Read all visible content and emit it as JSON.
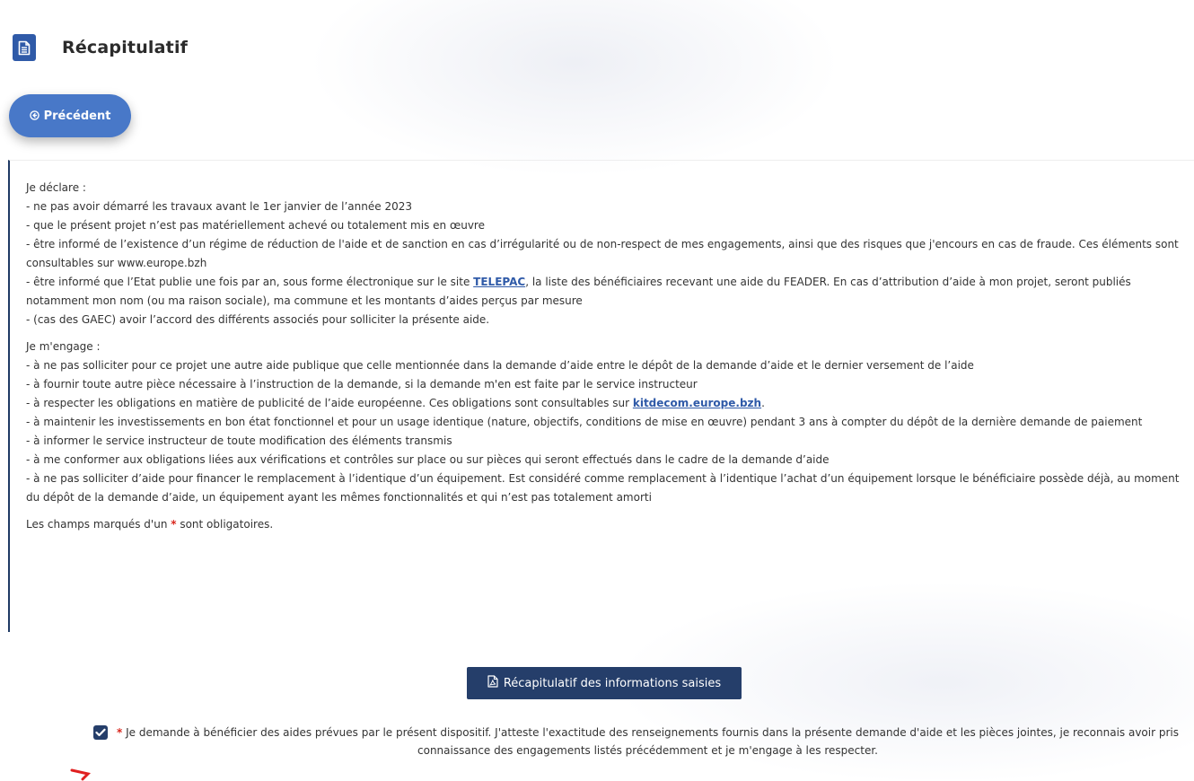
{
  "header": {
    "title": "Récapitulatif",
    "icon": "document-icon"
  },
  "prev_button": {
    "label": "Précédent",
    "icon": "arrow-left-circle-icon"
  },
  "declaration": {
    "heading": "Je déclare :",
    "items": [
      " - ne pas avoir démarré les travaux avant le 1er janvier de l’année 2023",
      " - que le présent projet n’est pas matériellement achevé ou totalement mis en œuvre",
      " - être informé de l’existence d’un régime de réduction de l'aide et de sanction en cas d’irrégularité ou de non-respect de mes engagements, ainsi que des risques que j'encours en cas de fraude. Ces éléments sont consultables sur www.europe.bzh"
    ],
    "telepac_before": " - être informé que l’Etat publie une fois par an, sous forme électronique sur le site ",
    "telepac_link": "TELEPAC",
    "telepac_after": ", la liste des bénéficiaires recevant une aide du FEADER. En cas d’attribution d’aide à mon projet, seront publiés notamment mon nom (ou ma raison sociale), ma commune et les montants d’aides perçus par mesure",
    "last_item": " - (cas des GAEC) avoir l’accord des différents associés pour solliciter la présente aide."
  },
  "engagement": {
    "heading": "Je m'engage :",
    "items_before": [
      " - à ne pas solliciter pour ce projet une autre aide publique que celle mentionnée dans la demande d’aide entre le dépôt de la demande d’aide et le dernier versement de l’aide",
      " - à fournir toute autre pièce nécessaire à l’instruction de la demande, si la demande m'en est faite par le service instructeur"
    ],
    "kitdecom_before": " - à respecter les obligations en matière de publicité de l’aide européenne. Ces obligations sont consultables sur ",
    "kitdecom_link": "kitdecom.europe.bzh",
    "kitdecom_after": ".",
    "items_after": [
      "- à maintenir les investissements en bon état fonctionnel et pour un usage identique (nature, objectifs, conditions de mise en œuvre) pendant 3 ans à compter du dépôt de la dernière demande de paiement",
      " - à informer le service instructeur de toute modification des éléments transmis",
      " - à me conformer aux obligations liées aux vérifications et contrôles sur place ou sur pièces qui seront effectués dans le cadre de la demande d’aide",
      " - à ne pas solliciter d’aide pour financer le remplacement à l’identique d’un équipement. Est considéré comme remplacement à l’identique l’achat d’un équipement lorsque le bénéficiaire possède déjà, au moment du dépôt de la demande d’aide, un équipement ayant les mêmes fonctionnalités et qui n’est pas totalement amorti"
    ]
  },
  "required_note": {
    "before": "Les champs marqués d'un ",
    "star": "*",
    "after": " sont obligatoires."
  },
  "summary_button": {
    "label": "Récapitulatif des informations saisies",
    "icon": "pdf-file-icon"
  },
  "consent": {
    "checked": true,
    "star": "*",
    "text": " Je demande à bénéficier des aides prévues par le présent dispositif. J'atteste l'exactitude des renseignements fournis dans la présente demande d'aide et les pièces jointes, je reconnais avoir pris connaissance des engagements listés précédemment et je m'engage à les respecter."
  },
  "colors": {
    "primary": "#2f5aa8",
    "button_light": "#4878c8",
    "button_dark": "#253e6a",
    "required": "#d9271e",
    "accent_border": "#1f3a64"
  }
}
